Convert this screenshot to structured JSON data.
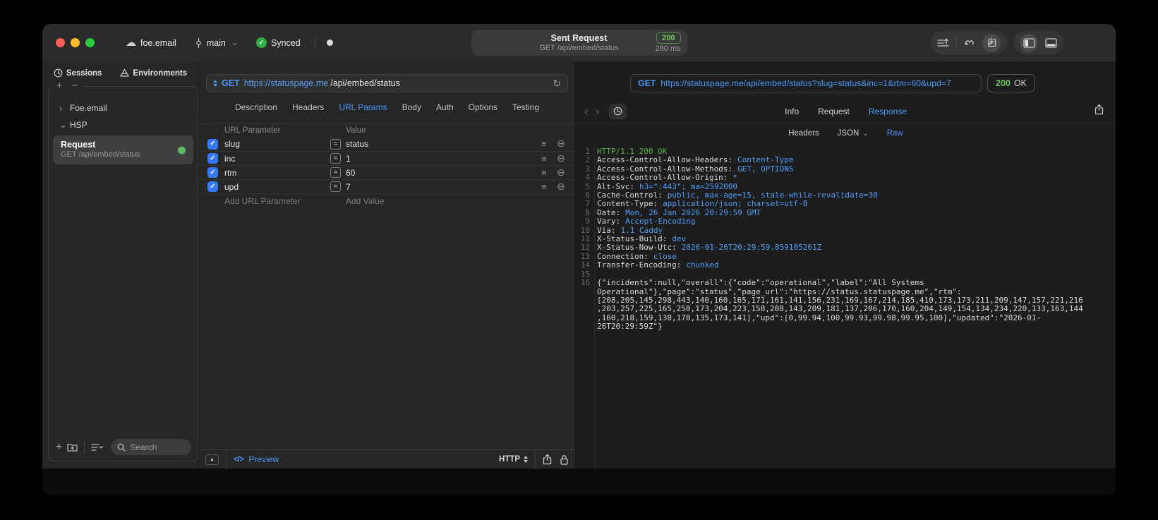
{
  "titlebar": {
    "project": "foe.email",
    "branch": "main",
    "sync_label": "Synced",
    "request_summary": {
      "title": "Sent Request",
      "subtitle": "GET /api/embed/status",
      "status_code": "200",
      "duration": "280 ms"
    }
  },
  "sidebar": {
    "tabs": [
      {
        "label": "Sessions"
      },
      {
        "label": "Environments"
      }
    ],
    "groups": [
      {
        "chevron": "›",
        "label": "Foe.email"
      },
      {
        "chevron": "⌄",
        "label": "HSP"
      }
    ],
    "request_item": {
      "title": "Request",
      "subtitle": "GET /api/embed/status"
    },
    "search_placeholder": "Search"
  },
  "editor": {
    "method": "GET",
    "url_host": "https://statuspage.me",
    "url_path": "/api/embed/status",
    "tabs": [
      "Description",
      "Headers",
      "URL Params",
      "Body",
      "Auth",
      "Options",
      "Testing"
    ],
    "active_tab": "URL Params",
    "table": {
      "param_header": "URL Parameter",
      "value_header": "Value",
      "rows": [
        {
          "name": "slug",
          "value": "status"
        },
        {
          "name": "inc",
          "value": "1"
        },
        {
          "name": "rtm",
          "value": "60"
        },
        {
          "name": "upd",
          "value": "7"
        }
      ],
      "add_param_label": "Add URL Parameter",
      "add_value_label": "Add Value"
    },
    "footer": {
      "preview_icon": "</>",
      "preview_label": "Preview",
      "protocol_label": "HTTP"
    }
  },
  "response": {
    "method": "GET",
    "url": "https://statuspage.me/api/embed/status?slug=status&inc=1&rtm=60&upd=7",
    "status_code": "200",
    "status_text": "OK",
    "tabs": [
      "Info",
      "Request",
      "Response"
    ],
    "active_tab": "Response",
    "subtabs": [
      "Headers",
      "JSON",
      "Raw"
    ],
    "active_subtab": "Raw",
    "raw": {
      "status_line": {
        "num": "1",
        "text": "HTTP/1.1 200 OK"
      },
      "headers": [
        {
          "num": "2",
          "name": "Access-Control-Allow-Headers:",
          "value": "Content-Type"
        },
        {
          "num": "3",
          "name": "Access-Control-Allow-Methods:",
          "value": "GET, OPTIONS"
        },
        {
          "num": "4",
          "name": "Access-Control-Allow-Origin:",
          "value": "*"
        },
        {
          "num": "5",
          "name": "Alt-Svc:",
          "value": "h3=\":443\"; ma=2592000"
        },
        {
          "num": "6",
          "name": "Cache-Control:",
          "value": "public, max-age=15, stale-while-revalidate=30"
        },
        {
          "num": "7",
          "name": "Content-Type:",
          "value": "application/json; charset=utf-8"
        },
        {
          "num": "8",
          "name": "Date:",
          "value": "Mon, 26 Jan 2026 20:29:59 GMT"
        },
        {
          "num": "9",
          "name": "Vary:",
          "value": "Accept-Encoding"
        },
        {
          "num": "10",
          "name": "Via:",
          "value": "1.1 Caddy"
        },
        {
          "num": "11",
          "name": "X-Status-Build:",
          "value": "dev"
        },
        {
          "num": "12",
          "name": "X-Status-Now-Utc:",
          "value": "2026-01-26T20:29:59.859105261Z"
        },
        {
          "num": "13",
          "name": "Connection:",
          "value": "close"
        },
        {
          "num": "14",
          "name": "Transfer-Encoding:",
          "value": "chunked"
        }
      ],
      "blank_line_num": "15",
      "body_line": {
        "num": "16",
        "text": "{\"incidents\":null,\"overall\":{\"code\":\"operational\",\"label\":\"All Systems Operational\"},\"page\":\"status\",\"page_url\":\"https://status.statuspage.me\",\"rtm\":[208,205,145,298,443,140,160,165,171,161,141,156,231,169,167,214,185,410,173,173,211,209,147,157,221,216,203,257,225,165,250,173,204,223,158,208,143,209,181,137,206,170,160,204,149,154,134,234,220,133,163,144,160,218,159,138,178,135,173,141],\"upd\":[0,99.94,100,99.93,99.98,99.95,100],\"updated\":\"2026-01-26T20:29:59Z\"}"
      }
    }
  },
  "colors": {
    "accent_blue": "#4a96f7",
    "status_green": "#62c554",
    "checkbox_blue": "#3478f6"
  }
}
